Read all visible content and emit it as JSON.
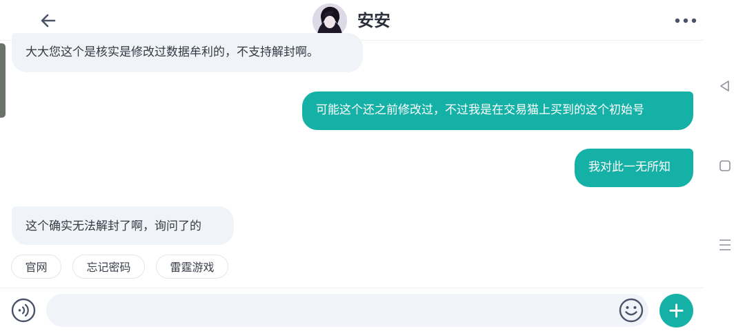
{
  "header": {
    "title": "安安",
    "icons": {
      "back": "arrow-left-icon",
      "avatar": "user-avatar",
      "more": "more-dots-icon"
    }
  },
  "messages": [
    {
      "direction": "incoming",
      "text": "大大您这个是核实是修改过数据牟利的，不支持解封啊。"
    },
    {
      "direction": "outgoing",
      "text": "可能这个还之前修改过，不过我是在交易猫上买到的这个初始号"
    },
    {
      "direction": "outgoing",
      "text": "我对此一无所知"
    },
    {
      "direction": "incoming",
      "text": "这个确实无法解封了啊，询问了的"
    }
  ],
  "quick_replies": [
    "官网",
    "忘记密码",
    "雷霆游戏"
  ],
  "input": {
    "value": "",
    "placeholder": "",
    "icons": {
      "voice": "voice-icon",
      "emoji": "emoji-icon",
      "add": "plus-icon"
    }
  },
  "system_nav": {
    "icons": [
      "nav-back-triangle-icon",
      "nav-home-square-icon",
      "nav-recents-menu-icon"
    ]
  },
  "colors": {
    "accent": "#16b1a6",
    "incoming_bubble": "#f0f3f7",
    "icon_gray": "#4a5268",
    "text_dark": "#333a44"
  }
}
